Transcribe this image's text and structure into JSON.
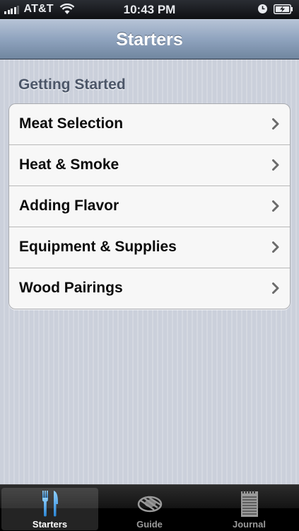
{
  "status_bar": {
    "carrier": "AT&T",
    "time": "10:43 PM",
    "icons": [
      "signal-bars-icon",
      "wifi-icon",
      "alarm-clock-icon",
      "battery-charging-icon"
    ]
  },
  "nav_bar": {
    "title": "Starters"
  },
  "section": {
    "header": "Getting Started",
    "items": [
      {
        "label": "Meat Selection"
      },
      {
        "label": "Heat & Smoke"
      },
      {
        "label": "Adding Flavor"
      },
      {
        "label": "Equipment & Supplies"
      },
      {
        "label": "Wood Pairings"
      }
    ]
  },
  "tab_bar": {
    "tabs": [
      {
        "label": "Starters",
        "icon": "fork-knife-icon",
        "selected": true
      },
      {
        "label": "Guide",
        "icon": "grill-steak-icon",
        "selected": false
      },
      {
        "label": "Journal",
        "icon": "notepad-icon",
        "selected": false
      }
    ]
  },
  "colors": {
    "nav_bar": "#8fa3be",
    "selected_tab_icon": "#4fa8ec",
    "section_header": "#4c5668"
  }
}
